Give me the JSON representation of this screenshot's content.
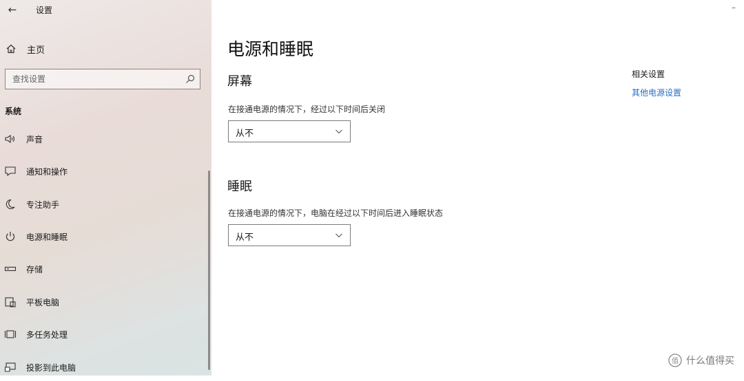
{
  "window": {
    "app_title": "设置",
    "minimize_glyph": "–"
  },
  "sidebar": {
    "back_glyph": "←",
    "home_label": "主页",
    "search_placeholder": "查找设置",
    "section_label": "系统",
    "items": [
      {
        "label": "声音",
        "icon": "speaker-icon"
      },
      {
        "label": "通知和操作",
        "icon": "notification-icon"
      },
      {
        "label": "专注助手",
        "icon": "moon-icon"
      },
      {
        "label": "电源和睡眠",
        "icon": "power-icon"
      },
      {
        "label": "存储",
        "icon": "storage-icon"
      },
      {
        "label": "平板电脑",
        "icon": "tablet-icon"
      },
      {
        "label": "多任务处理",
        "icon": "multitask-icon"
      },
      {
        "label": "投影到此电脑",
        "icon": "project-icon"
      }
    ]
  },
  "main": {
    "title": "电源和睡眠",
    "screen": {
      "heading": "屏幕",
      "description": "在接通电源的情况下，经过以下时间后关闭",
      "value": "从不"
    },
    "sleep": {
      "heading": "睡眠",
      "description": "在接通电源的情况下，电脑在经过以下时间后进入睡眠状态",
      "value": "从不"
    },
    "related": {
      "title": "相关设置",
      "link": "其他电源设置"
    }
  },
  "watermark": {
    "text": "什么值得买",
    "logo_glyph": "值"
  },
  "colors": {
    "link": "#2a6fc6",
    "sidebar_bg": "#e9dcd8"
  }
}
